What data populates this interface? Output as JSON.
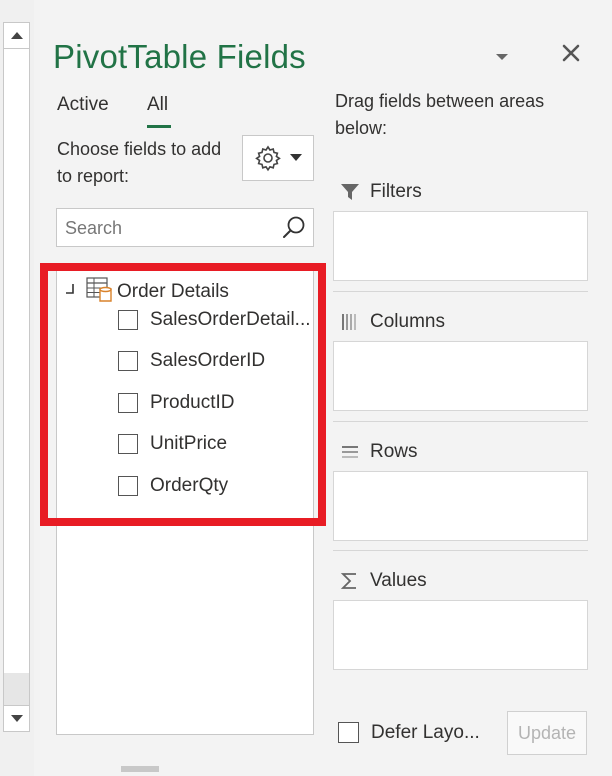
{
  "pane": {
    "title": "PivotTable Fields",
    "tabs": [
      {
        "label": "Active",
        "selected": false
      },
      {
        "label": "All",
        "selected": true
      }
    ],
    "choose_label": "Choose fields to add to report:",
    "search": {
      "placeholder": "Search",
      "value": ""
    },
    "table": {
      "name": "Order Details",
      "fields": [
        {
          "label": "SalesOrderDetail...",
          "checked": false
        },
        {
          "label": "SalesOrderID",
          "checked": false
        },
        {
          "label": "ProductID",
          "checked": false
        },
        {
          "label": "UnitPrice",
          "checked": false
        },
        {
          "label": "OrderQty",
          "checked": false
        }
      ]
    },
    "drag_hint": "Drag fields between areas below:",
    "areas": {
      "filters": "Filters",
      "columns": "Columns",
      "rows": "Rows",
      "values": "Values"
    },
    "defer_label": "Defer Layo...",
    "update_label": "Update"
  },
  "colors": {
    "accent": "#217346",
    "highlight": "#e81c24"
  },
  "icons": {
    "scroll_up": "scroll-up-arrow-icon",
    "scroll_down": "scroll-down-arrow-icon",
    "pane_menu": "chevron-down-icon",
    "close": "close-icon",
    "settings": "gear-icon",
    "search": "search-icon",
    "table": "table-icon",
    "filters": "filter-funnel-icon",
    "columns": "columns-icon",
    "rows": "rows-icon",
    "values": "sigma-icon"
  }
}
